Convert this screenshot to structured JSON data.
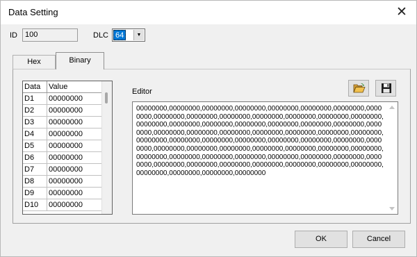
{
  "window": {
    "title": "Data Setting"
  },
  "id_field": {
    "label": "ID",
    "value": "100"
  },
  "dlc": {
    "label": "DLC",
    "value": "64"
  },
  "tabs": [
    {
      "label": "Hex"
    },
    {
      "label": "Binary"
    }
  ],
  "grid": {
    "headers": [
      "Data",
      "Value"
    ],
    "rows": [
      [
        "D1",
        "00000000"
      ],
      [
        "D2",
        "00000000"
      ],
      [
        "D3",
        "00000000"
      ],
      [
        "D4",
        "00000000"
      ],
      [
        "D5",
        "00000000"
      ],
      [
        "D6",
        "00000000"
      ],
      [
        "D7",
        "00000000"
      ],
      [
        "D8",
        "00000000"
      ],
      [
        "D9",
        "00000000"
      ],
      [
        "D10",
        "00000000"
      ]
    ]
  },
  "editor": {
    "label": "Editor",
    "text": "00000000,00000000,00000000,00000000,00000000,00000000,00000000,00000000,00000000,00000000,00000000,00000000,00000000,00000000,00000000,00000000,00000000,00000000,00000000,00000000,00000000,00000000,00000000,00000000,00000000,00000000,00000000,00000000,00000000,00000000,00000000,00000000,00000000,00000000,00000000,00000000,00000000,00000000,00000000,00000000,00000000,00000000,00000000,00000000,00000000,00000000,00000000,00000000,00000000,00000000,00000000,00000000,00000000,00000000,00000000,00000000,00000000,00000000,00000000,00000000,00000000,00000000,00000000,00000000"
  },
  "icons": {
    "open": "open-folder-icon",
    "save": "floppy-disk-icon",
    "close": "close-icon"
  },
  "buttons": {
    "ok": "OK",
    "cancel": "Cancel"
  },
  "colors": {
    "selection": "#0078d7",
    "folder": "#f2c14e"
  }
}
